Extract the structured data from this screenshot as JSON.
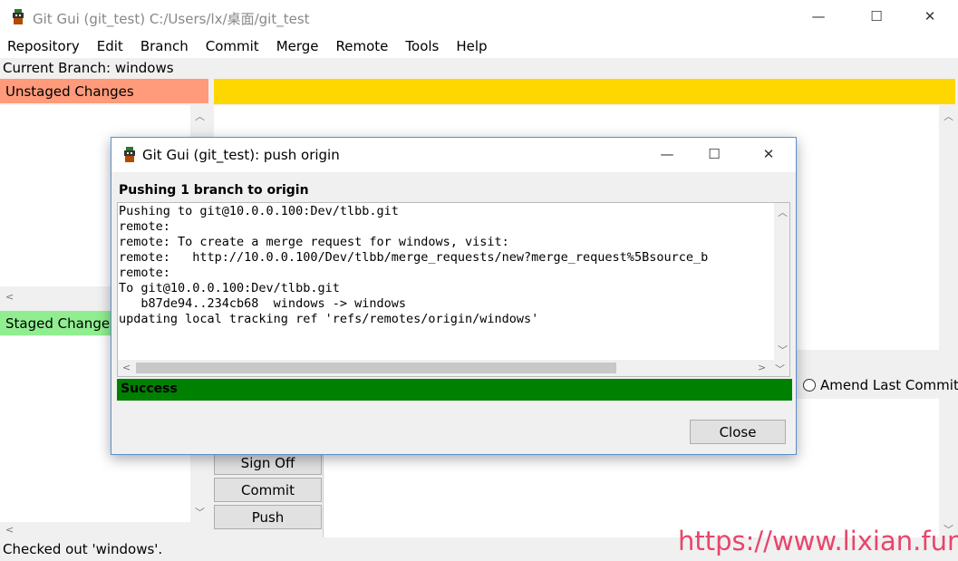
{
  "window": {
    "title": "Git Gui (git_test) C:/Users/lx/桌面/git_test",
    "controls": {
      "minimize": "—",
      "maximize": "☐",
      "close": "✕"
    }
  },
  "menu": [
    "Repository",
    "Edit",
    "Branch",
    "Commit",
    "Merge",
    "Remote",
    "Tools",
    "Help"
  ],
  "current_branch": "Current Branch: windows",
  "unstaged": {
    "label": "Unstaged Changes",
    "color": "#ff9a7a"
  },
  "staged": {
    "label": "Staged Changes",
    "color": "#90ee90"
  },
  "diff_header_color": "#ffd700",
  "commit_options": {
    "amend_label": "Amend Last Commit",
    "partial_left": "t"
  },
  "buttons": {
    "sign_off": "Sign Off",
    "commit": "Commit",
    "push": "Push"
  },
  "status": "Checked out 'windows'.",
  "watermark": "https://www.lixian.fun",
  "dialog": {
    "title": "Git Gui (git_test): push origin",
    "heading": "Pushing 1 branch to origin",
    "log": [
      "Pushing to git@10.0.0.100:Dev/tlbb.git",
      "remote:",
      "remote: To create a merge request for windows, visit:",
      "remote:   http://10.0.0.100/Dev/tlbb/merge_requests/new?merge_request%5Bsource_b",
      "remote:",
      "To git@10.0.0.100:Dev/tlbb.git",
      "   b87de94..234cb68  windows -> windows",
      "updating local tracking ref 'refs/remotes/origin/windows'"
    ],
    "result": "Success",
    "result_color": "#008000",
    "close_label": "Close"
  }
}
